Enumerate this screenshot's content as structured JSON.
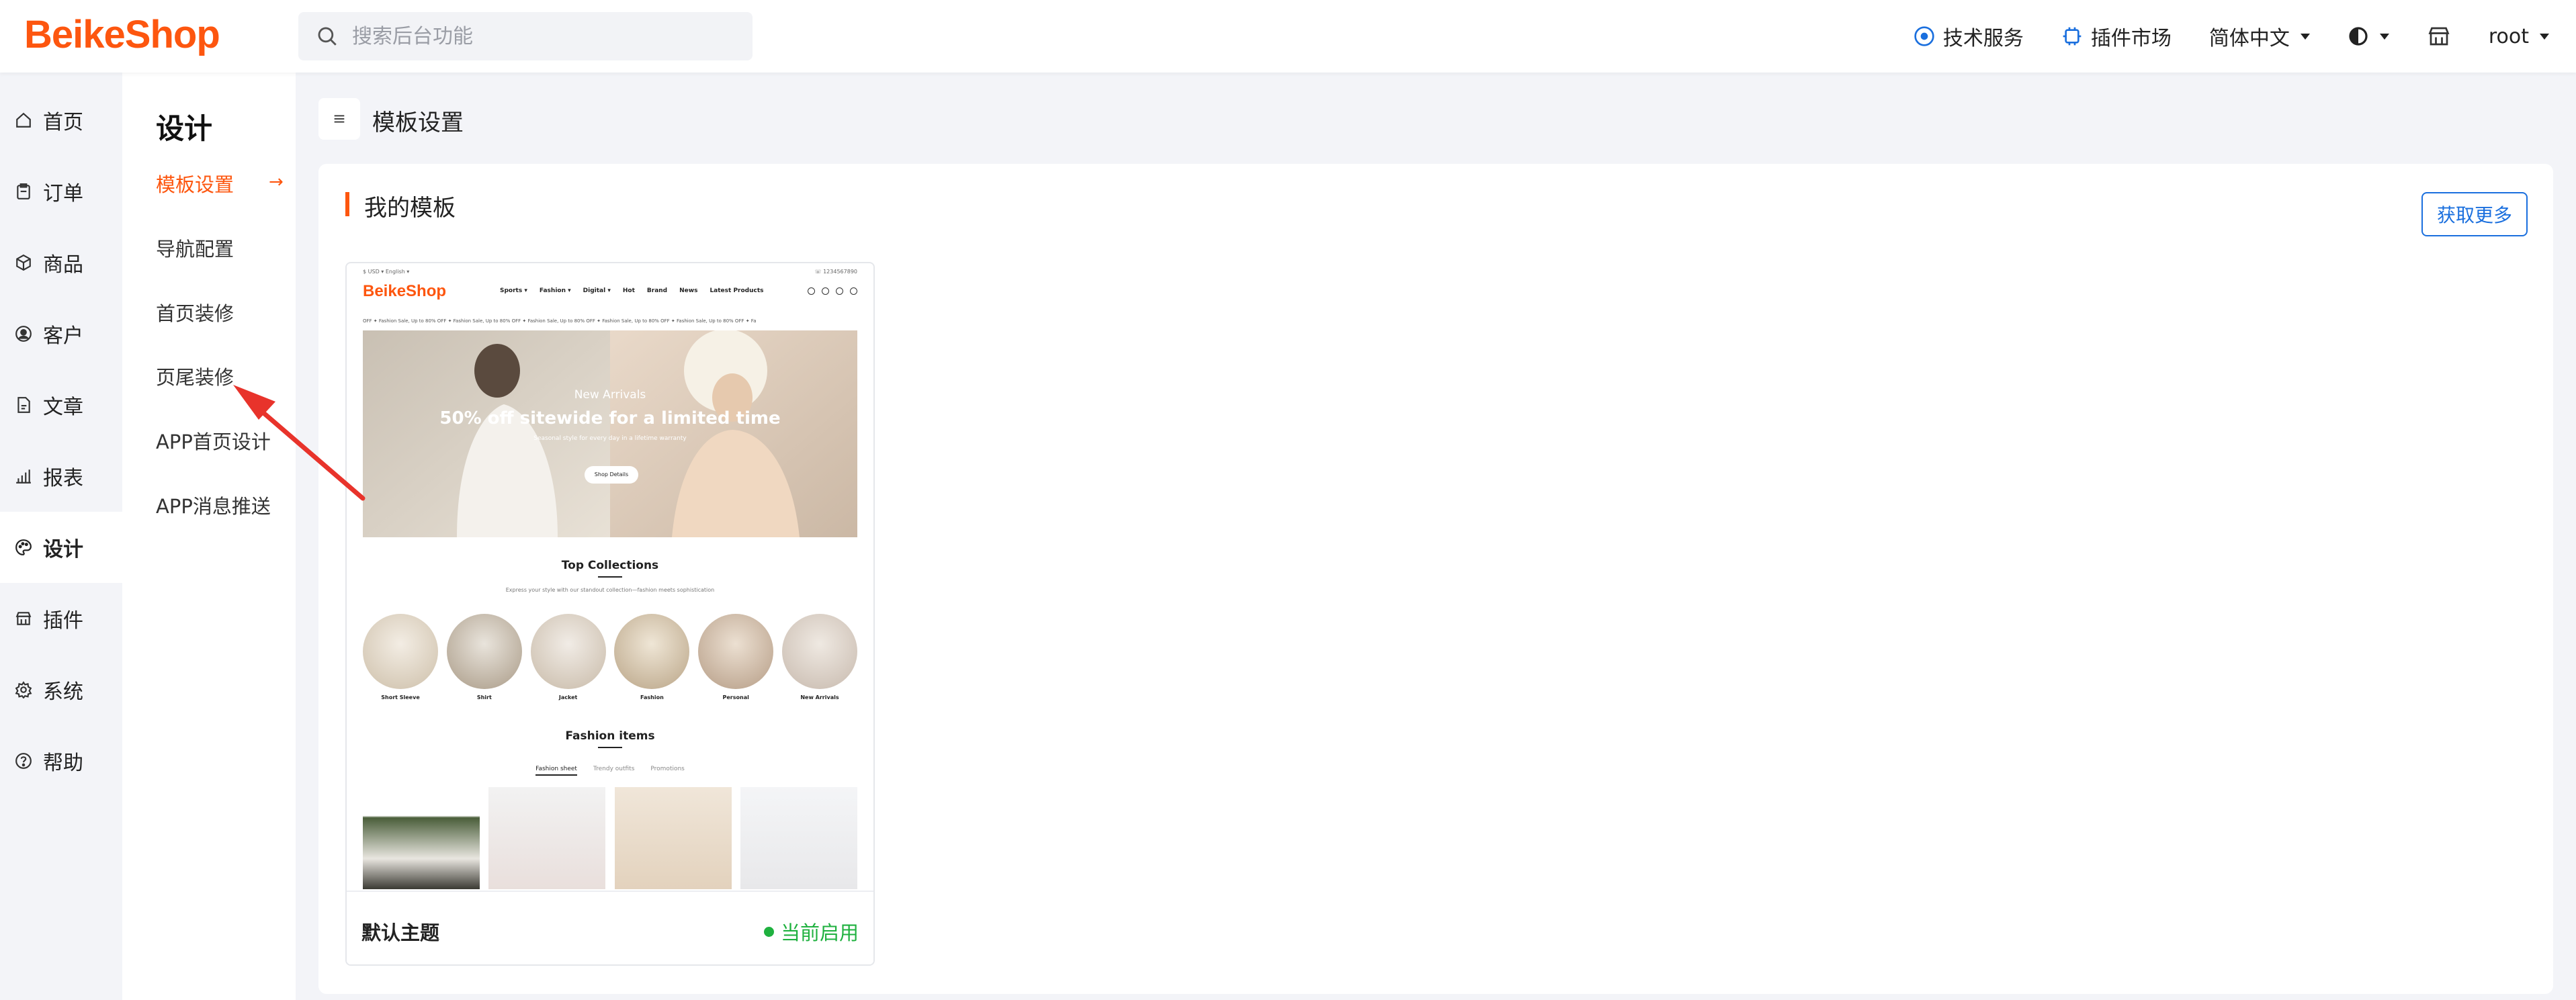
{
  "header": {
    "logo": "BeikeShop",
    "search_placeholder": "搜索后台功能",
    "tech_service": "技术服务",
    "plugin_market": "插件市场",
    "language": "简体中文",
    "user": "root"
  },
  "rail": {
    "items": [
      {
        "label": "首页",
        "icon": "home-icon"
      },
      {
        "label": "订单",
        "icon": "clipboard-icon"
      },
      {
        "label": "商品",
        "icon": "box-icon"
      },
      {
        "label": "客户",
        "icon": "user-circle-icon"
      },
      {
        "label": "文章",
        "icon": "document-icon"
      },
      {
        "label": "报表",
        "icon": "bar-chart-icon"
      },
      {
        "label": "设计",
        "icon": "palette-icon"
      },
      {
        "label": "插件",
        "icon": "store-icon"
      },
      {
        "label": "系统",
        "icon": "gear-icon"
      },
      {
        "label": "帮助",
        "icon": "help-icon"
      }
    ],
    "active_index": 6
  },
  "subnav": {
    "title": "设计",
    "items": [
      "模板设置",
      "导航配置",
      "首页装修",
      "页尾装修",
      "APP首页设计",
      "APP消息推送"
    ],
    "active_index": 0
  },
  "main": {
    "page_title": "模板设置",
    "card_title": "我的模板",
    "more_button": "获取更多",
    "theme": {
      "name": "默认主题",
      "status": "当前启用"
    },
    "preview": {
      "currency": "$ USD ▾   English ▾",
      "phone": "☏ 1234567890",
      "logo": "BeikeShop",
      "nav": [
        "Sports ▾",
        "Fashion ▾",
        "Digital ▾",
        "Hot",
        "Brand",
        "News",
        "Latest Products"
      ],
      "ticker": "OFF   ✦   Fashion Sale, Up to 80% OFF   ✦   Fashion Sale, Up to 80% OFF   ✦   Fashion Sale, Up to 80% OFF   ✦   Fashion Sale, Up to 80% OFF   ✦   Fashion Sale, Up to 80% OFF   ✦   Fa",
      "hero_kicker": "New Arrivals",
      "hero_title": "50% off sitewide for a limited time",
      "hero_sub": "Seasonal style for every day in a lifetime warranty",
      "hero_button": "Shop Details",
      "collections_title": "Top Collections",
      "collections_sub": "Express your style with our standout collection—fashion meets sophistication",
      "collections": [
        "Short Sleeve",
        "Shirt",
        "Jacket",
        "Fashion",
        "Personal",
        "New Arrivals"
      ],
      "items_title": "Fashion items",
      "tabs": [
        "Fashion sheet",
        "Trendy outfits",
        "Promotions"
      ]
    }
  },
  "colors": {
    "accent": "#fd560f",
    "link_blue": "#1a6fde",
    "status_green": "#1fb13f"
  }
}
